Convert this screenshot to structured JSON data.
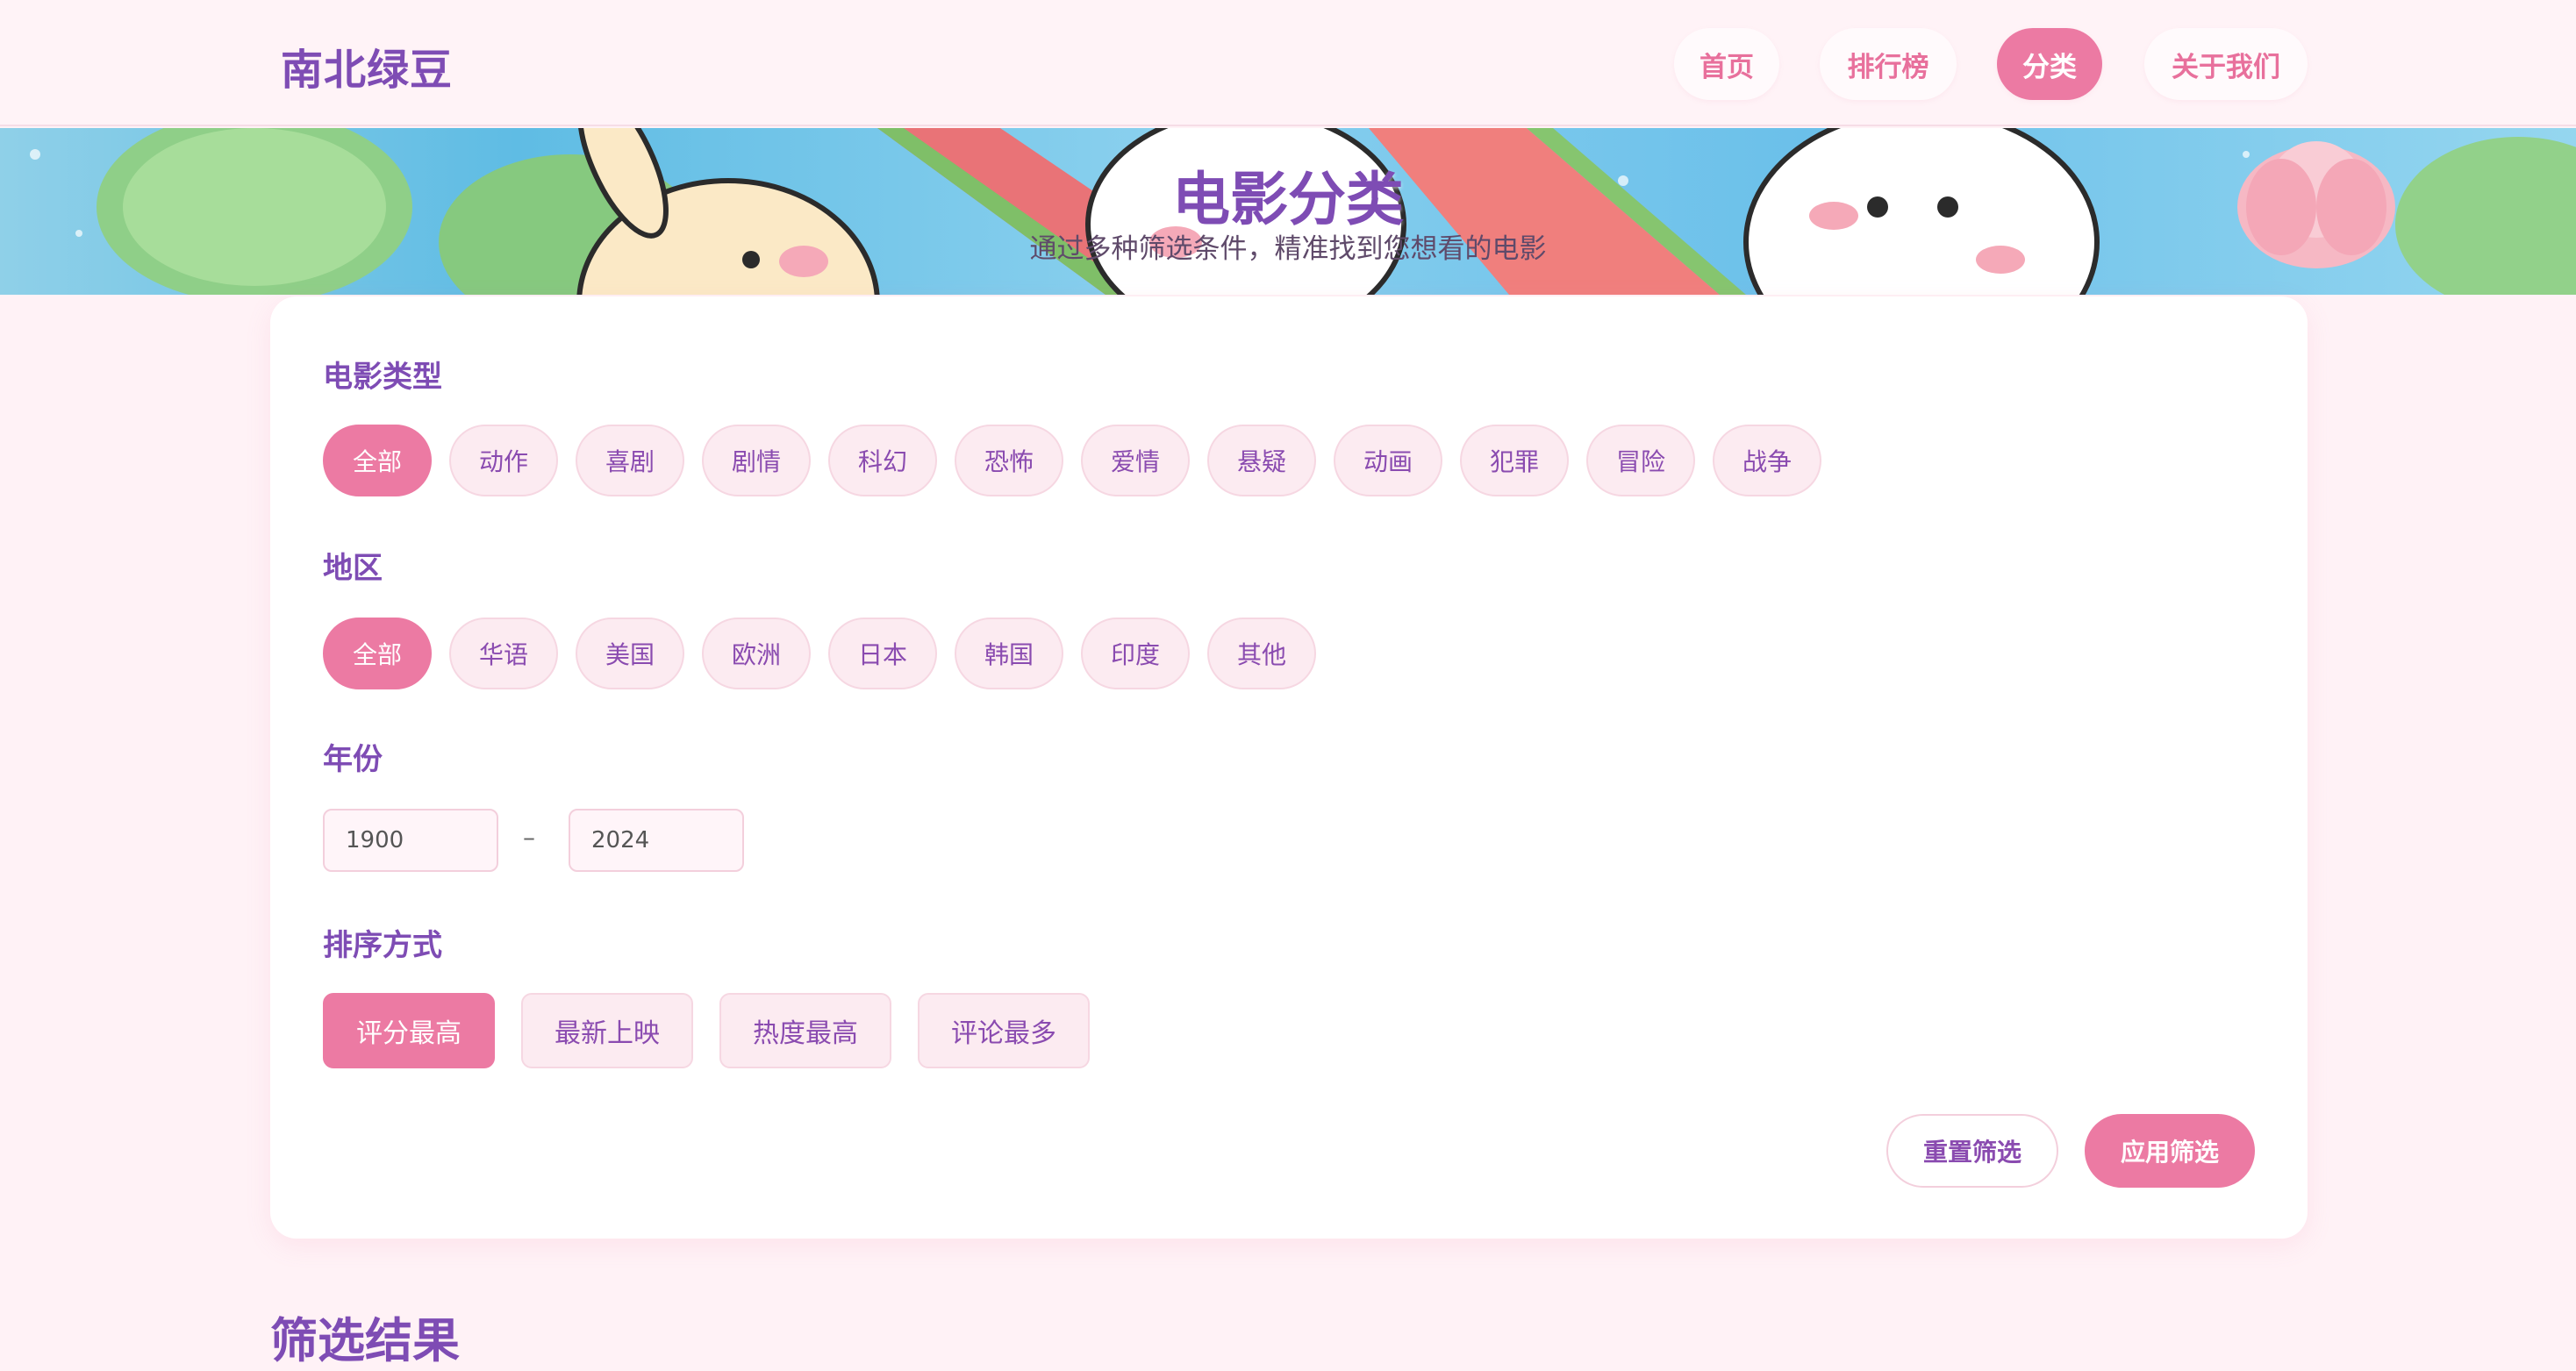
{
  "header": {
    "logo": "南北绿豆",
    "nav": [
      "首页",
      "排行榜",
      "分类",
      "关于我们"
    ],
    "active_nav": "分类"
  },
  "banner": {
    "title": "电影分类",
    "subtitle": "通过多种筛选条件，精准找到您想看的电影"
  },
  "filters": {
    "genre": {
      "title": "电影类型",
      "options": [
        "全部",
        "动作",
        "喜剧",
        "剧情",
        "科幻",
        "恐怖",
        "爱情",
        "悬疑",
        "动画",
        "犯罪",
        "冒险",
        "战争"
      ],
      "selected": "全部"
    },
    "region": {
      "title": "地区",
      "options": [
        "全部",
        "华语",
        "美国",
        "欧洲",
        "日本",
        "韩国",
        "印度",
        "其他"
      ],
      "selected": "全部"
    },
    "year": {
      "title": "年份",
      "from": "1900",
      "to": "2024",
      "separator": "–"
    },
    "sort": {
      "title": "排序方式",
      "options": [
        "评分最高",
        "最新上映",
        "热度最高",
        "评论最多"
      ],
      "selected": "评分最高"
    },
    "reset_label": "重置筛选",
    "apply_label": "应用筛选"
  },
  "results": {
    "title": "筛选结果"
  },
  "colors": {
    "accent": "#ec7aa3",
    "brand": "#7e4cb4",
    "chip_bg": "#fcebf1",
    "page_bg": "#fff2f6"
  }
}
